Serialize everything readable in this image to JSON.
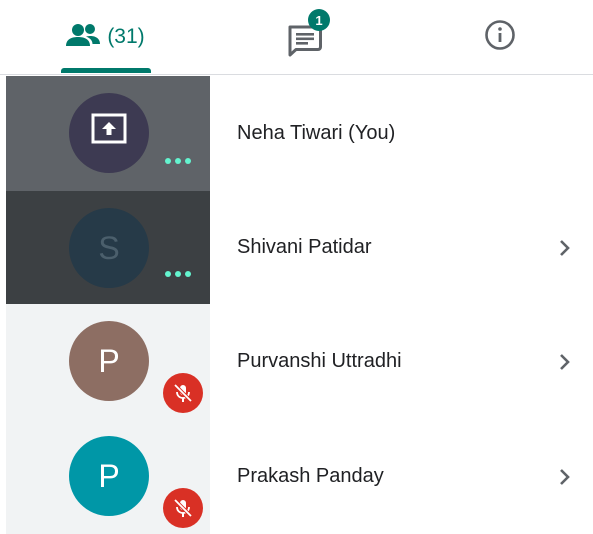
{
  "tabs": {
    "people_count": "(31)",
    "chat_badge": "1"
  },
  "participants": [
    {
      "name": "Neha Tiwari (You)",
      "avatar_letter": "",
      "avatar_icon": "screen-share-icon",
      "status": "speaking-dots",
      "has_chevron": false
    },
    {
      "name": "Shivani Patidar",
      "avatar_letter": "S",
      "status": "speaking-dots",
      "has_chevron": true
    },
    {
      "name": "Purvanshi Uttradhi",
      "avatar_letter": "P",
      "status": "muted",
      "has_chevron": true
    },
    {
      "name": "Prakash Panday",
      "avatar_letter": "P",
      "status": "muted",
      "has_chevron": true
    }
  ],
  "colors": {
    "accent": "#00796b",
    "muted_badge": "#d93025",
    "speaking_dots": "#64f4cf"
  }
}
